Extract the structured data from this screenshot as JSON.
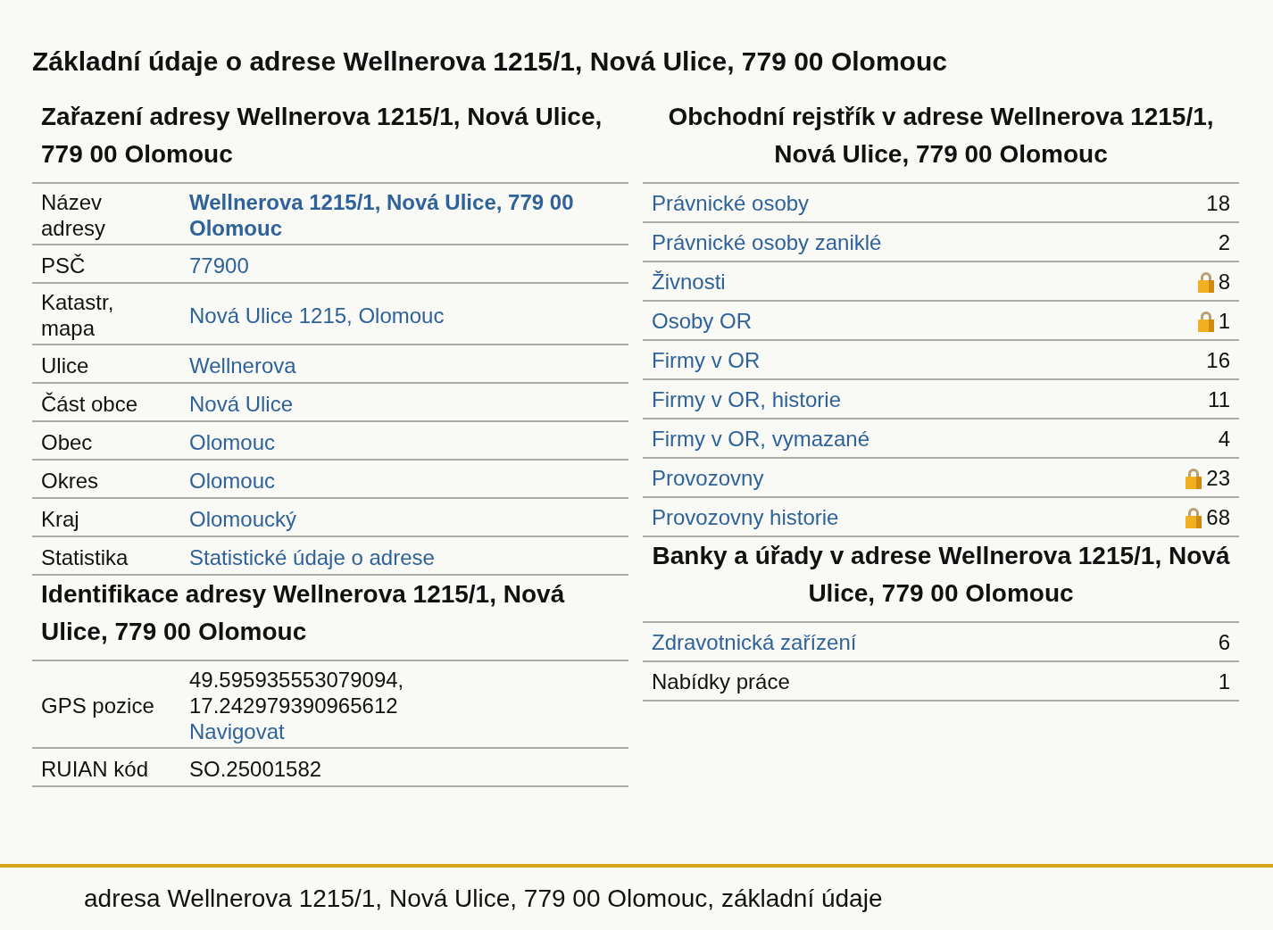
{
  "title": "Základní údaje o adrese Wellnerova 1215/1, Nová Ulice, 779 00 Olomouc",
  "left": [
    {
      "heading": "Zařazení adresy Wellnerova 1215/1, Nová Ulice, 779 00 Olomouc",
      "rows": [
        {
          "label": "Název adresy",
          "lines": [
            {
              "text": "Wellnerova 1215/1, Nová Ulice, 779 00 Olomouc",
              "kind": "strong-link"
            }
          ]
        },
        {
          "label": "PSČ",
          "lines": [
            {
              "text": "77900",
              "kind": "link"
            }
          ]
        },
        {
          "label": "Katastr, mapa",
          "lines": [
            {
              "text": "Nová Ulice 1215, Olomouc",
              "kind": "link"
            }
          ]
        },
        {
          "label": "Ulice",
          "lines": [
            {
              "text": "Wellnerova",
              "kind": "link"
            }
          ]
        },
        {
          "label": "Část obce",
          "lines": [
            {
              "text": "Nová Ulice",
              "kind": "link"
            }
          ]
        },
        {
          "label": "Obec",
          "lines": [
            {
              "text": "Olomouc",
              "kind": "link"
            }
          ]
        },
        {
          "label": "Okres",
          "lines": [
            {
              "text": "Olomouc",
              "kind": "link"
            }
          ]
        },
        {
          "label": "Kraj",
          "lines": [
            {
              "text": "Olomoucký",
              "kind": "link"
            }
          ]
        },
        {
          "label": "Statistika",
          "lines": [
            {
              "text": "Statistické údaje o adrese",
              "kind": "link"
            }
          ]
        }
      ]
    },
    {
      "heading": "Identifikace adresy Wellnerova 1215/1, Nová Ulice, 779 00 Olomouc",
      "rows": [
        {
          "label": "GPS pozice",
          "lines": [
            {
              "text": "49.595935553079094,",
              "kind": "plain"
            },
            {
              "text": "17.242979390965612",
              "kind": "plain"
            },
            {
              "text": "Navigovat",
              "kind": "link"
            }
          ]
        },
        {
          "label": "RUIAN kód",
          "lines": [
            {
              "text": "SO.25001582",
              "kind": "plain"
            }
          ]
        }
      ]
    }
  ],
  "right": [
    {
      "heading": "Obchodní rejstřík v adrese Wellnerova 1215/1, Nová Ulice, 779 00 Olomouc",
      "rows": [
        {
          "label": "Právnické osoby",
          "kind": "link",
          "count": "18",
          "locked": false
        },
        {
          "label": "Právnické osoby zaniklé",
          "kind": "link",
          "count": "2",
          "locked": false
        },
        {
          "label": "Živnosti",
          "kind": "link",
          "count": "8",
          "locked": true
        },
        {
          "label": "Osoby OR",
          "kind": "link",
          "count": "1",
          "locked": true
        },
        {
          "label": "Firmy v OR",
          "kind": "link",
          "count": "16",
          "locked": false
        },
        {
          "label": "Firmy v OR, historie",
          "kind": "link",
          "count": "11",
          "locked": false
        },
        {
          "label": "Firmy v OR, vymazané",
          "kind": "link",
          "count": "4",
          "locked": false
        },
        {
          "label": "Provozovny",
          "kind": "link",
          "count": "23",
          "locked": true
        },
        {
          "label": "Provozovny historie",
          "kind": "link",
          "count": "68",
          "locked": true
        }
      ]
    },
    {
      "heading": "Banky a úřady v adrese Wellnerova 1215/1, Nová Ulice, 779 00 Olomouc",
      "rows": [
        {
          "label": "Zdravotnická zařízení",
          "kind": "link",
          "count": "6",
          "locked": false
        },
        {
          "label": "Nabídky práce",
          "kind": "plain",
          "count": "1",
          "locked": false
        }
      ]
    }
  ],
  "footer": "adresa Wellnerova 1215/1, Nová Ulice, 779 00 Olomouc, základní údaje"
}
